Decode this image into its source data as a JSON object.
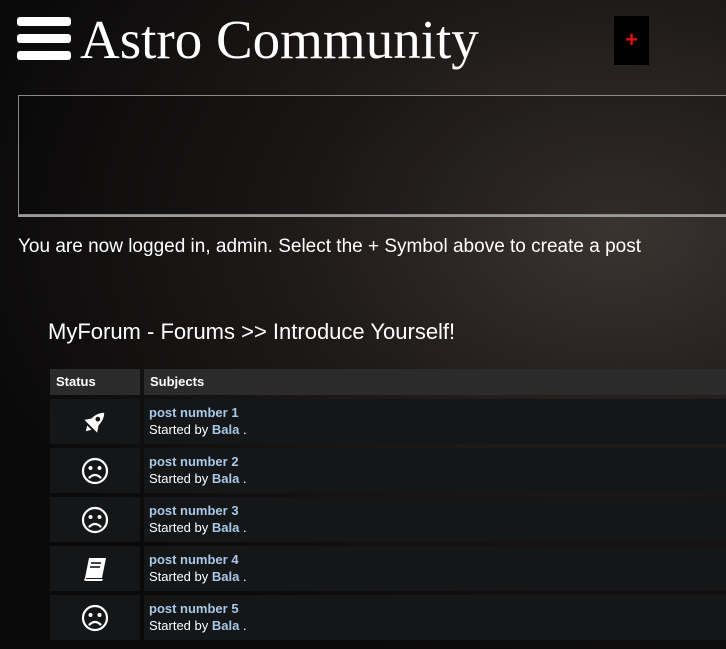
{
  "header": {
    "title": "Astro Community",
    "new_post": "+"
  },
  "login_message": "You are now logged in, admin. Select the + Symbol above to create a post",
  "breadcrumb": "MyForum - Forums >> Introduce Yourself!",
  "table": {
    "headers": {
      "status": "Status",
      "subjects": "Subjects"
    },
    "started_by_prefix": "Started by",
    "rows": [
      {
        "status_icon": "rocket-icon",
        "title": "post number 1",
        "author": "Bala",
        "suffix": "."
      },
      {
        "status_icon": "sad-face-icon",
        "title": "post number 2",
        "author": "Bala",
        "suffix": "."
      },
      {
        "status_icon": "sad-face-icon",
        "title": "post number 3",
        "author": "Bala",
        "suffix": "."
      },
      {
        "status_icon": "book-icon",
        "title": "post number 4",
        "author": "Bala",
        "suffix": "."
      },
      {
        "status_icon": "sad-face-icon",
        "title": "post number 5",
        "author": "Bala",
        "suffix": "."
      }
    ]
  },
  "colors": {
    "plus": "#e01010",
    "link": "#a8c8e8",
    "header_bg": "#2b2b2b",
    "row_bg": "#141618"
  }
}
